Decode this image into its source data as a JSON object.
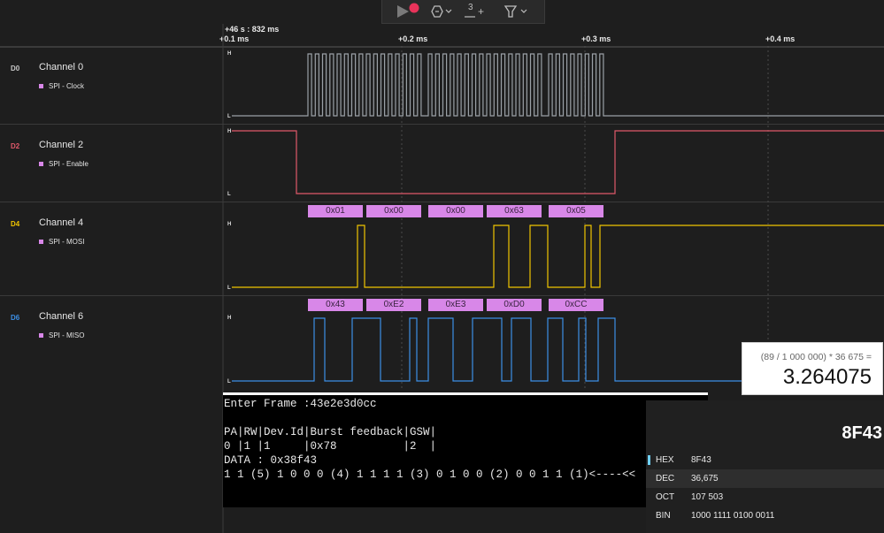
{
  "toolbar": {
    "stepper_value": "3",
    "stepper_plus": "+"
  },
  "header": {
    "cursor_time": "+46 s : 832 ms",
    "ticks": [
      "+0.1 ms",
      "+0.2 ms",
      "+0.3 ms",
      "+0.4 ms"
    ]
  },
  "level_labels": {
    "high": "H",
    "low": "L"
  },
  "channels": [
    {
      "id": "D0",
      "name": "Channel 0",
      "analyzer": "SPI - Clock",
      "color": "#9aa0a6"
    },
    {
      "id": "D2",
      "name": "Channel 2",
      "analyzer": "SPI - Enable",
      "color": "#e0596a"
    },
    {
      "id": "D4",
      "name": "Channel 4",
      "analyzer": "SPI - MOSI",
      "color": "#f0c400"
    },
    {
      "id": "D6",
      "name": "Channel 6",
      "analyzer": "SPI - MISO",
      "color": "#3c8fe6"
    }
  ],
  "decoded": {
    "mosi": [
      "0x01",
      "0x00",
      "0x00",
      "0x63",
      "0x05"
    ],
    "miso": [
      "0x43",
      "0xE2",
      "0xE3",
      "0xD0",
      "0xCC"
    ]
  },
  "terminal": {
    "lines": [
      "Enter Frame :43e2e3d0cc",
      "",
      "PA|RW|Dev.Id|Burst feedback|GSW|",
      "0 |1 |1     |0x78          |2  |",
      "DATA : 0x38f43",
      "1 1 (5) 1 0 0 0 (4) 1 1 1 1 (3) 0 1 0 0 (2) 0 0 1 1 (1)<----<<"
    ]
  },
  "calculator": {
    "expression": "(89 / 1 000 000) * 36 675 =",
    "result": "3.264075"
  },
  "programmer": {
    "display": "8F43",
    "rows": [
      {
        "key": "HEX",
        "value": "8F43"
      },
      {
        "key": "DEC",
        "value": "36,675"
      },
      {
        "key": "OCT",
        "value": "107 503"
      },
      {
        "key": "BIN",
        "value": "1000 1111 0100 0011"
      }
    ]
  }
}
